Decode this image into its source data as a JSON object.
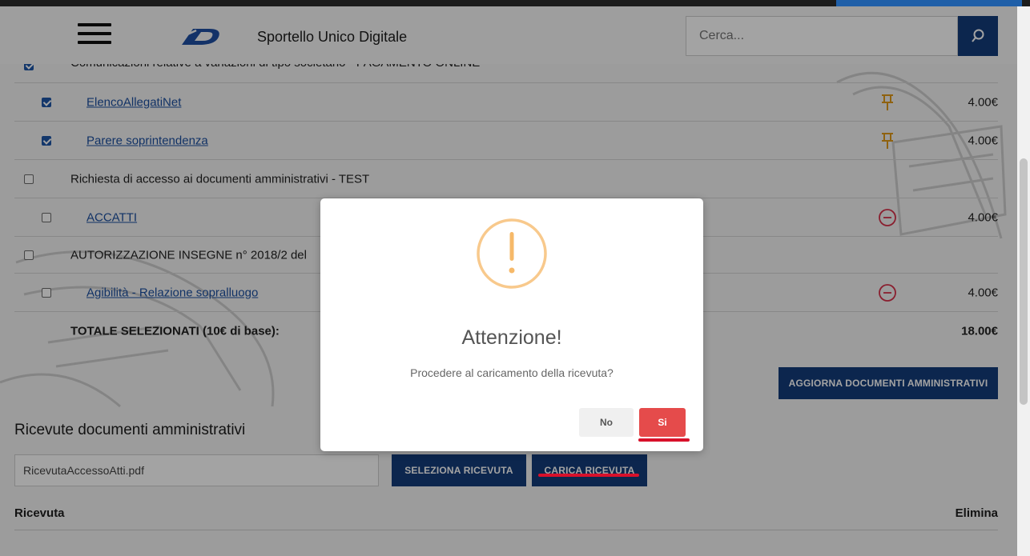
{
  "header": {
    "title": "Sportello Unico Digitale",
    "search_placeholder": "Cerca...",
    "logo": "d-logo-icon",
    "menu_icon": "hamburger-icon",
    "search_icon": "search-icon"
  },
  "documents": [
    {
      "label": "Comunicazioni relative a variazioni di tipo societario - PAGAMENTO ONLINE",
      "checked": true,
      "link": false
    },
    {
      "label": "ElencoAllegatiNet",
      "checked": true,
      "link": true,
      "status": "pin-icon",
      "price": "4.00€"
    },
    {
      "label": "Parere soprintendenza",
      "checked": true,
      "link": true,
      "status": "pin-icon",
      "price": "4.00€"
    },
    {
      "label": "Richiesta di accesso ai documenti amministrativi - TEST",
      "checked": false,
      "link": false
    },
    {
      "label": "ACCATTI",
      "checked": false,
      "link": true,
      "status": "minus-circle-icon",
      "price": "4.00€"
    },
    {
      "label": "AUTORIZZAZIONE INSEGNE n° 2018/2 del",
      "checked": false,
      "link": false
    },
    {
      "label": "Agibilità - Relazione sopralluogo",
      "checked": false,
      "link": true,
      "status": "minus-circle-icon",
      "price": "4.00€"
    }
  ],
  "totals": {
    "label": "TOTALE SELEZIONATI (10€ di base):",
    "value": "18.00€"
  },
  "update_button": "AGGIORNA DOCUMENTI AMMINISTRATIVI",
  "receipts": {
    "title": "Ricevute documenti amministrativi",
    "file_value": "RicevutaAccessoAtti.pdf",
    "select_button": "SELEZIONA RICEVUTA",
    "upload_button": "CARICA RICEVUTA",
    "col_receipt": "Ricevuta",
    "col_delete": "Elimina"
  },
  "modal": {
    "icon": "warning-icon",
    "title": "Attenzione!",
    "text": "Procedere al caricamento della ricevuta?",
    "no_label": "No",
    "yes_label": "Si"
  },
  "colors": {
    "primary": "#133c7a",
    "link": "#1c4fa0",
    "pin": "#e09a1a",
    "minus": "#d8314a",
    "warning": "#f8c98c",
    "confirm": "#e54b4b",
    "annotation": "#d8112b"
  }
}
